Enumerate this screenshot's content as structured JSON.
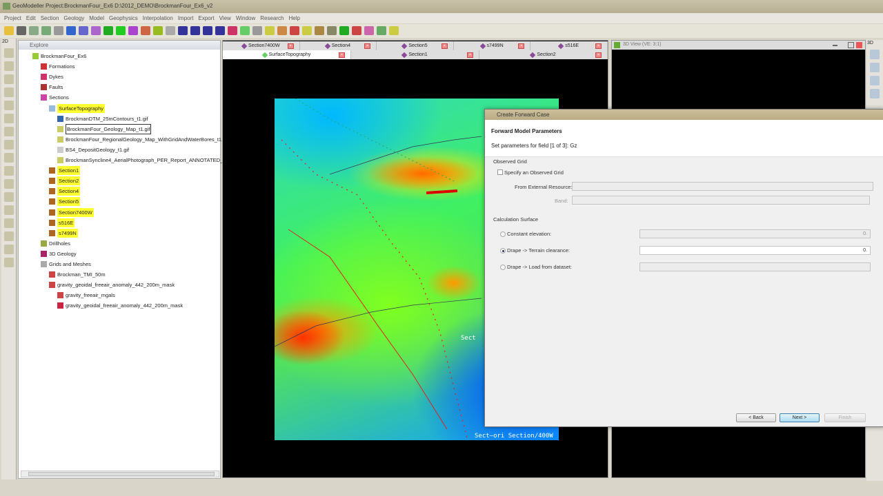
{
  "window": {
    "title": "GeoModeller Project:BrockmanFour_Ex6   D:\\2012_DEMO\\BrockmanFour_Ex6_v2"
  },
  "menu": [
    "Project",
    "Edit",
    "Section",
    "Geology",
    "Model",
    "Geophysics",
    "Interpolation",
    "Import",
    "Export",
    "View",
    "Window",
    "Research",
    "Help"
  ],
  "left_toolbar": {
    "mode_label": "2D"
  },
  "right_toolbar": {
    "mode_label": "3D"
  },
  "explorer": {
    "title": "Explore",
    "items": [
      {
        "label": "BrockmanFour_Ex6",
        "level": 0,
        "highlight": false
      },
      {
        "label": "Formations",
        "level": 1,
        "highlight": false
      },
      {
        "label": "Dykes",
        "level": 1,
        "highlight": false
      },
      {
        "label": "Faults",
        "level": 1,
        "highlight": false
      },
      {
        "label": "Sections",
        "level": 1,
        "highlight": false
      },
      {
        "label": "SurfaceTopography",
        "level": 2,
        "highlight": true
      },
      {
        "label": "BrockmanDTM_25mContours_t1.gif",
        "level": 3,
        "highlight": false
      },
      {
        "label": "BrockmanFour_Geology_Map_t1.gif",
        "level": 3,
        "highlight": false,
        "selected": true
      },
      {
        "label": "BrockmanFour_RegionalGeology_Map_WithGridAndWaterBores_t1.gif",
        "level": 3,
        "highlight": false
      },
      {
        "label": "BS4_DepositGeology_t1.gif",
        "level": 3,
        "highlight": false
      },
      {
        "label": "BrockmanSyncline4_AerialPhotograph_PER_Report_ANNOTATED_t1.gif",
        "level": 3,
        "highlight": false
      },
      {
        "label": "Section1",
        "level": 2,
        "highlight": true
      },
      {
        "label": "Section2",
        "level": 2,
        "highlight": true
      },
      {
        "label": "Section4",
        "level": 2,
        "highlight": true
      },
      {
        "label": "Section5",
        "level": 2,
        "highlight": true
      },
      {
        "label": "Section7400W",
        "level": 2,
        "highlight": true
      },
      {
        "label": "s516E",
        "level": 2,
        "highlight": true
      },
      {
        "label": "s7499N",
        "level": 2,
        "highlight": true
      },
      {
        "label": "Drillholes",
        "level": 1,
        "highlight": false
      },
      {
        "label": "3D Geology",
        "level": 1,
        "highlight": false
      },
      {
        "label": "Grids and Meshes",
        "level": 1,
        "highlight": false
      },
      {
        "label": "Brockman_TMI_50m",
        "level": 2,
        "highlight": false
      },
      {
        "label": "gravity_geoidal_freeair_anomaly_442_200m_mask",
        "level": 2,
        "highlight": false
      },
      {
        "label": "gravity_freeair_mgals",
        "level": 3,
        "highlight": false
      },
      {
        "label": "gravity_geoidal_freeair_anomaly_442_200m_mask",
        "level": 3,
        "highlight": false
      }
    ]
  },
  "view2d": {
    "tabs_row1": [
      "Section7400W",
      "Section4",
      "Section5",
      "s7499N",
      "s516E"
    ],
    "tabs_row2": [
      "SurfaceTopography",
      "Section1",
      "Section2"
    ],
    "active_tab": "SurfaceTopography",
    "map_labels": [
      "Sect",
      "Sect–ori  Section/400W"
    ]
  },
  "view3d": {
    "title": "3D View (VE: 3:1)"
  },
  "dialog": {
    "title": "Create Forward Case",
    "heading": "Forward Model Parameters",
    "subheading": "Set parameters for field [1 of 3]: Gz",
    "observed_grid": {
      "group": "Observed Grid",
      "checkbox": "Specify an Observed Grid",
      "checked": false,
      "external_label": "From External Resource:",
      "external_value": "",
      "band_label": "Band:",
      "band_value": ""
    },
    "calc_surface": {
      "group": "Calculation Surface",
      "options": [
        {
          "label": "Constant elevation:",
          "value": "0.",
          "selected": false
        },
        {
          "label": "Drape -> Terrain clearance:",
          "value": "0.",
          "selected": true
        },
        {
          "label": "Drape -> Load from dataset:",
          "value": "",
          "selected": false
        }
      ]
    },
    "buttons": {
      "back": "< Back",
      "next": "Next >",
      "finish": "Finish"
    }
  }
}
